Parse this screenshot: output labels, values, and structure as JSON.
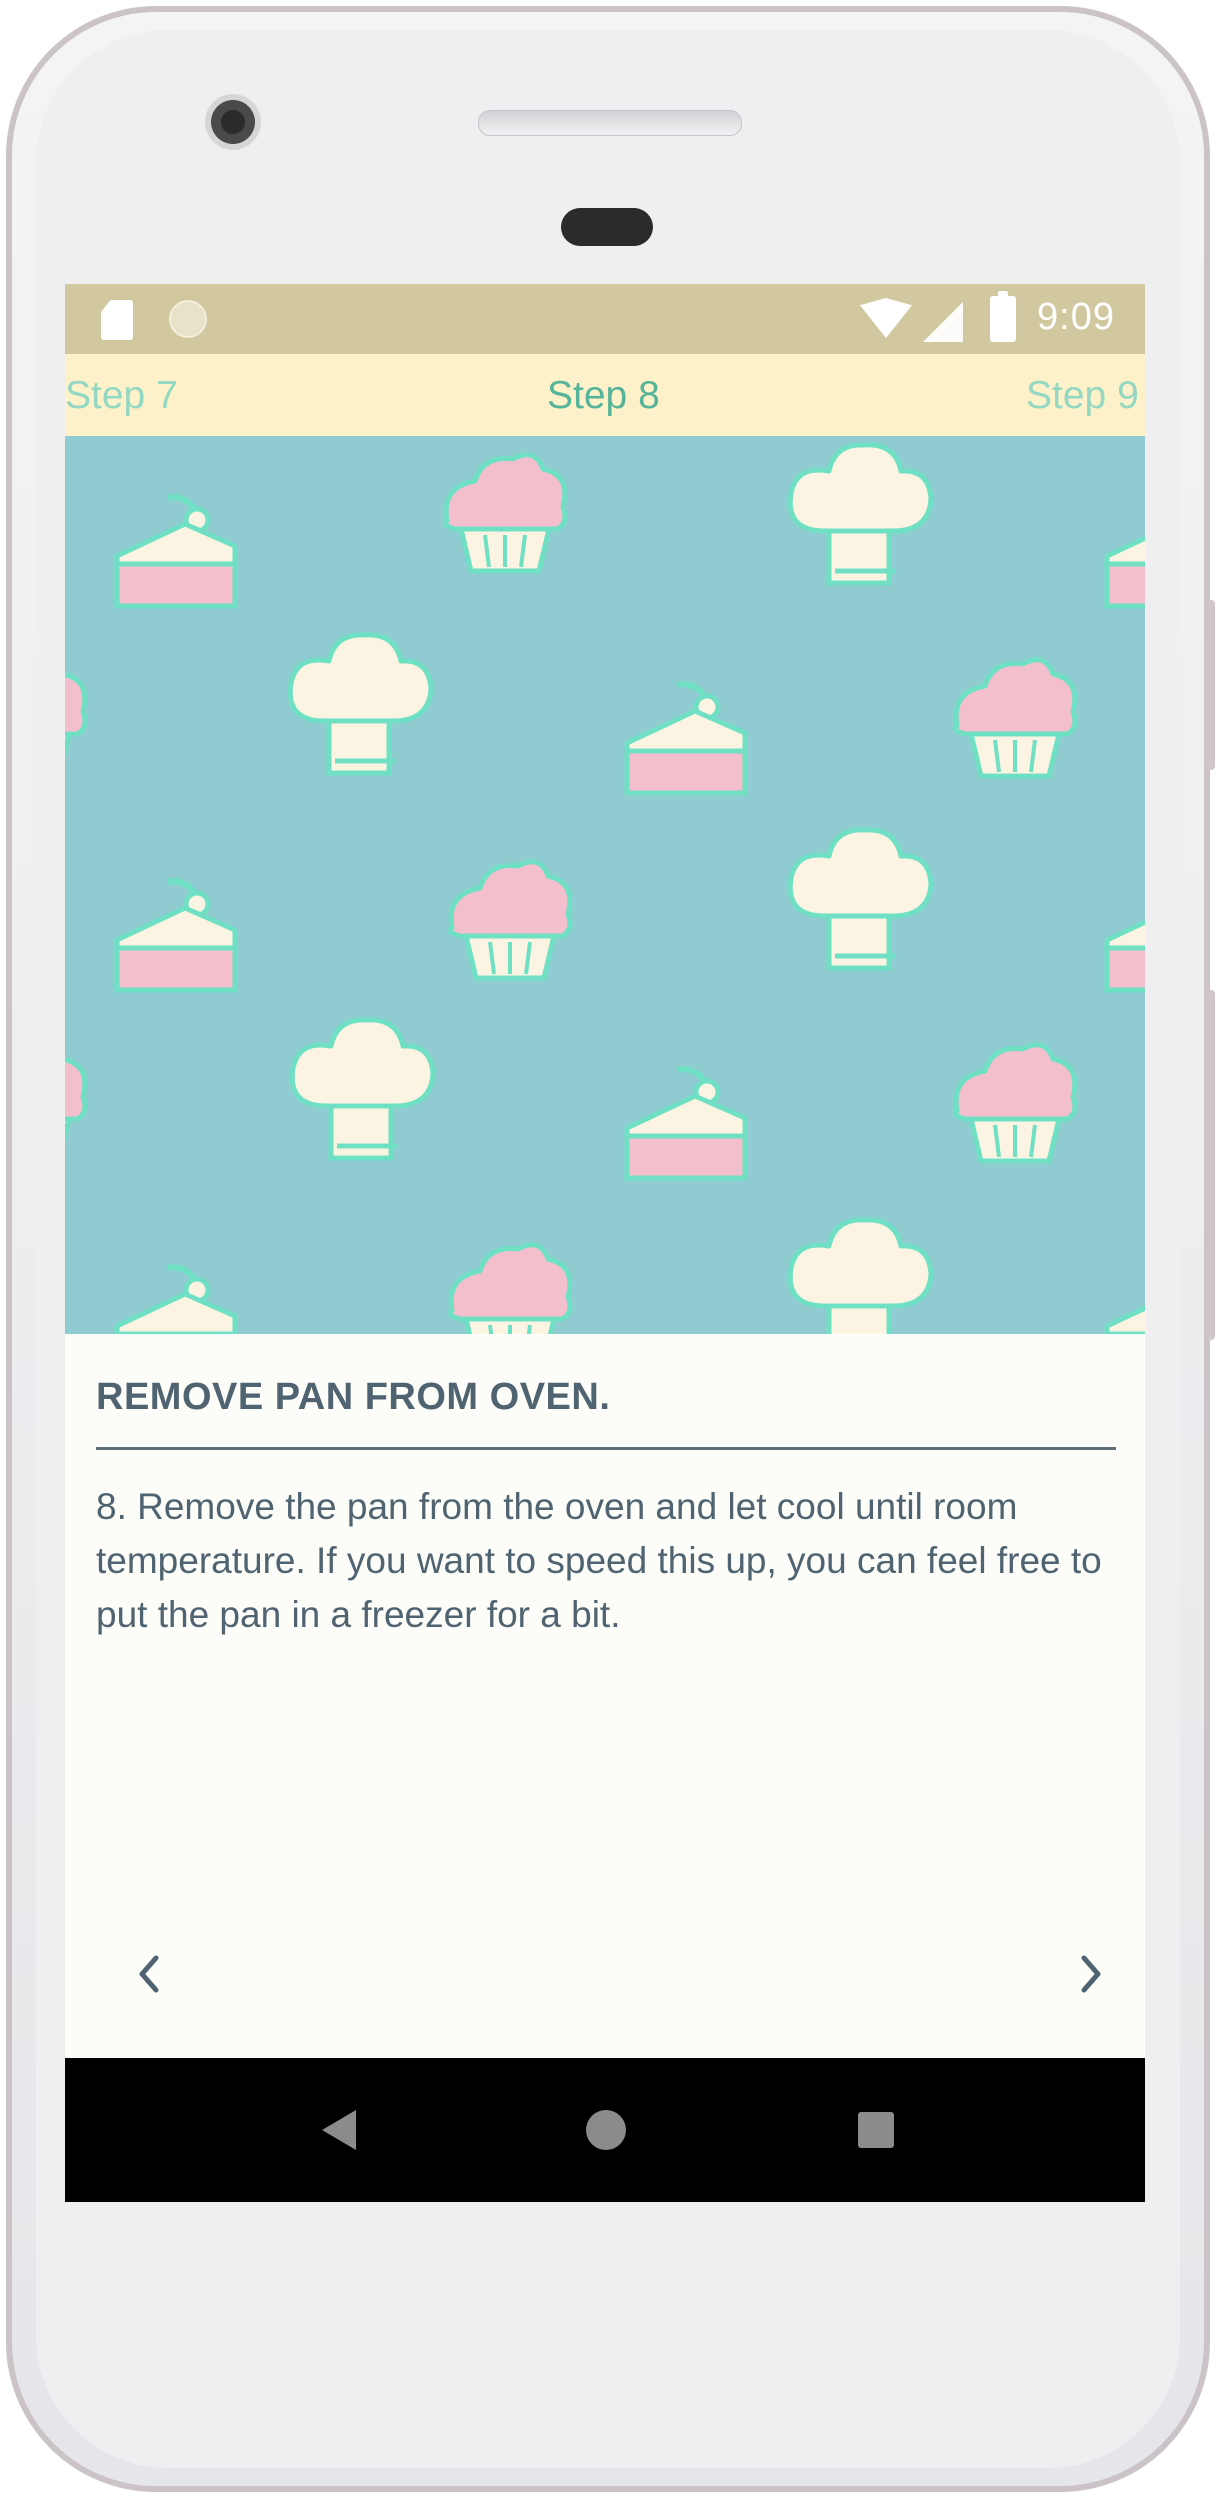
{
  "status_bar": {
    "time": "9:09",
    "icons": [
      "sd-card-icon",
      "circle-notification-icon",
      "wifi-icon",
      "signal-icon",
      "battery-charging-icon"
    ]
  },
  "step_tabs": {
    "previous": "Step 7",
    "current": "Step 8",
    "next": "Step 9"
  },
  "hero": {
    "pattern_icons": [
      "cake-slice-icon",
      "cupcake-icon",
      "chef-hat-icon"
    ],
    "colors": {
      "background": "#91cbd2",
      "pink": "#f4bfcd",
      "cream": "#fcf4e2",
      "mint": "#6fe0c4"
    }
  },
  "step": {
    "title": "REMOVE PAN FROM OVEN.",
    "description": "8. Remove the pan from the oven and let cool until room temperature. If you want to speed this up, you can feel free to put the pan in a freezer for a bit."
  },
  "navigation": {
    "prev_icon": "chevron-left-icon",
    "next_icon": "chevron-right-icon"
  },
  "system_nav": {
    "icons": [
      "back-icon",
      "home-icon",
      "recents-icon"
    ]
  }
}
